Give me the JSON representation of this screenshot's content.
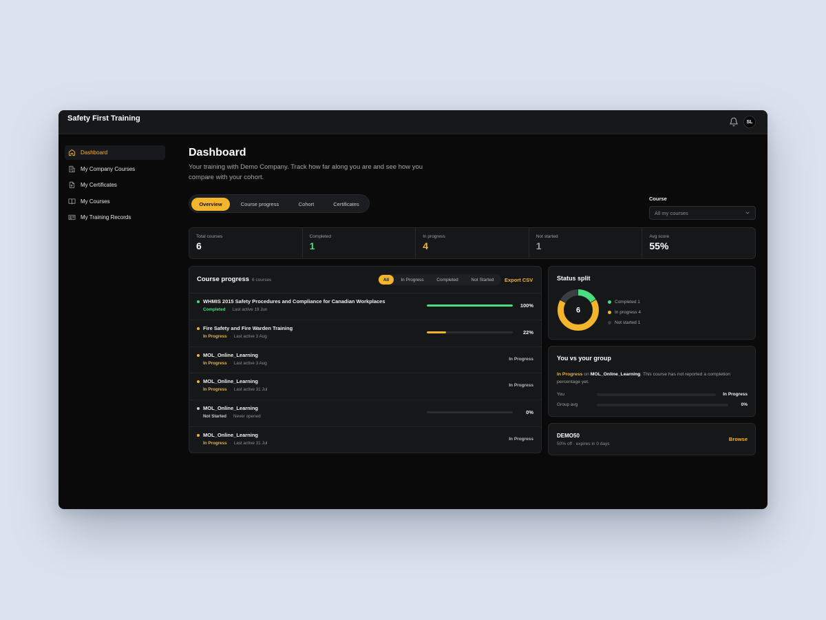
{
  "app": {
    "brand": "Safety First Training",
    "user_initials": "SL"
  },
  "sidebar": {
    "items": [
      {
        "label": "Dashboard",
        "icon": "home-icon",
        "active": true
      },
      {
        "label": "My Company Courses",
        "icon": "building-icon",
        "active": false
      },
      {
        "label": "My Certificates",
        "icon": "certificate-icon",
        "active": false
      },
      {
        "label": "My Courses",
        "icon": "book-icon",
        "active": false
      },
      {
        "label": "My Training Records",
        "icon": "id-card-icon",
        "active": false
      }
    ]
  },
  "header": {
    "title": "Dashboard",
    "subtitle": "Your training with Demo Company. Track how far along you are and see how you compare with your cohort."
  },
  "tabs": [
    {
      "label": "Overview",
      "active": true
    },
    {
      "label": "Course progress",
      "active": false
    },
    {
      "label": "Cohort",
      "active": false
    },
    {
      "label": "Certificates",
      "active": false
    }
  ],
  "course_filter": {
    "label": "Course",
    "value": "All my courses"
  },
  "stats": [
    {
      "label": "Total courses",
      "value": "6",
      "color": "#ffffff"
    },
    {
      "label": "Completed",
      "value": "1",
      "color": "#4ade80"
    },
    {
      "label": "In progress",
      "value": "4",
      "color": "#f3b52c"
    },
    {
      "label": "Not started",
      "value": "1",
      "color": "#9aa0a6"
    },
    {
      "label": "Avg score",
      "value": "55%",
      "color": "#ffffff"
    }
  ],
  "course_progress": {
    "title": "Course progress",
    "count": "6 courses",
    "filters": [
      {
        "label": "All",
        "active": true
      },
      {
        "label": "In Progress",
        "active": false
      },
      {
        "label": "Completed",
        "active": false
      },
      {
        "label": "Not Started",
        "active": false
      }
    ],
    "export_label": "Export CSV",
    "rows": [
      {
        "name": "WHMIS 2015 Safety Procedures and Compliance for Canadian Workplaces",
        "status": "Completed",
        "status_color": "#4ade80",
        "last": "Last active 19 Jun",
        "percent": 100,
        "percent_label": "100%",
        "right_text": ""
      },
      {
        "name": "Fire Safety and Fire Warden Training",
        "status": "In Progress",
        "status_color": "#f3b52c",
        "last": "Last active 3 Aug",
        "percent": 22,
        "percent_label": "22%",
        "right_text": ""
      },
      {
        "name": "MOL_Online_Learning",
        "status": "In Progress",
        "status_color": "#f3b52c",
        "last": "Last active 3 Aug",
        "percent": null,
        "percent_label": "",
        "right_text": "In Progress"
      },
      {
        "name": "MOL_Online_Learning",
        "status": "In Progress",
        "status_color": "#f3b52c",
        "last": "Last active 31 Jul",
        "percent": null,
        "percent_label": "",
        "right_text": "In Progress"
      },
      {
        "name": "MOL_Online_Learning",
        "status": "Not Started",
        "status_color": "#c9ccd1",
        "last": "Never opened",
        "percent": 0,
        "percent_label": "0%",
        "right_text": ""
      },
      {
        "name": "MOL_Online_Learning",
        "status": "In Progress",
        "status_color": "#f3b52c",
        "last": "Last active 31 Jul",
        "percent": null,
        "percent_label": "",
        "right_text": "In Progress"
      }
    ]
  },
  "status_split": {
    "title": "Status split",
    "total": "6",
    "segments": [
      {
        "label": "Completed 1",
        "value": 1,
        "color": "#4ade80"
      },
      {
        "label": "In progress 4",
        "value": 4,
        "color": "#f3b52c"
      },
      {
        "label": "Not started 1",
        "value": 1,
        "color": "#3a3d42"
      }
    ]
  },
  "comparison": {
    "title": "You vs your group",
    "status": "In Progress",
    "connector": " on ",
    "course": "MOL_Online_Learning",
    "note": ". This course has not reported a completion percentage yet.",
    "you_label": "You",
    "you_value": "In Progress",
    "group_label": "Group avg",
    "group_value": "0%"
  },
  "promo": {
    "code": "DEMO50",
    "detail": "50% off · expires in 0 days",
    "action": "Browse"
  }
}
